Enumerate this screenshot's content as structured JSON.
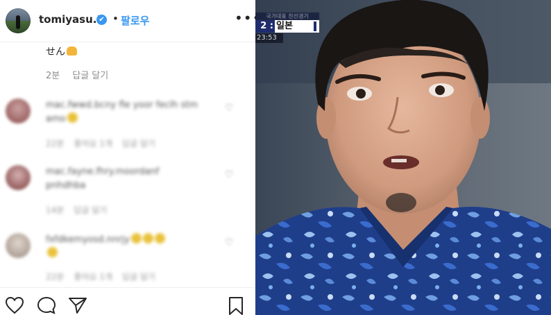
{
  "header": {
    "username": "tomiyasu.t",
    "verified_mark": "✔",
    "separator": "•",
    "follow_label": "팔로우",
    "more_label": "•••"
  },
  "top_comment": {
    "fragment_text": "せん",
    "time": "2분",
    "reply_label": "답글 달기"
  },
  "blurred_comments": [
    {
      "text_line1": "mac.fwwd.bcny fle yoor feclh stm",
      "text_line2": "amo",
      "meta": [
        "22분",
        "좋아요 1개",
        "답글 달기"
      ]
    },
    {
      "text_line1": "mac.fayne.fhry.moordanf",
      "text_line2": "pnhdhba",
      "meta": [
        "14분",
        "답글 달기"
      ]
    },
    {
      "text_line1": "fxfdkemyosd.nnrjy",
      "text_line2": "",
      "meta": [
        "22분",
        "좋아요 1개",
        "답글 달기"
      ]
    }
  ],
  "icons": {
    "like": "heart-icon",
    "comment": "comment-icon",
    "share": "share-icon",
    "save": "bookmark-icon",
    "more": "more-icon",
    "verified": "verified-icon"
  },
  "broadcast": {
    "banner": "국가대표 친선경기",
    "score": "2 : 2",
    "team": "일본",
    "clock": "23:53"
  },
  "colors": {
    "accent": "#3897f0",
    "text": "#262626",
    "muted": "#8e8e8e",
    "jersey": "#1f3e8a"
  }
}
